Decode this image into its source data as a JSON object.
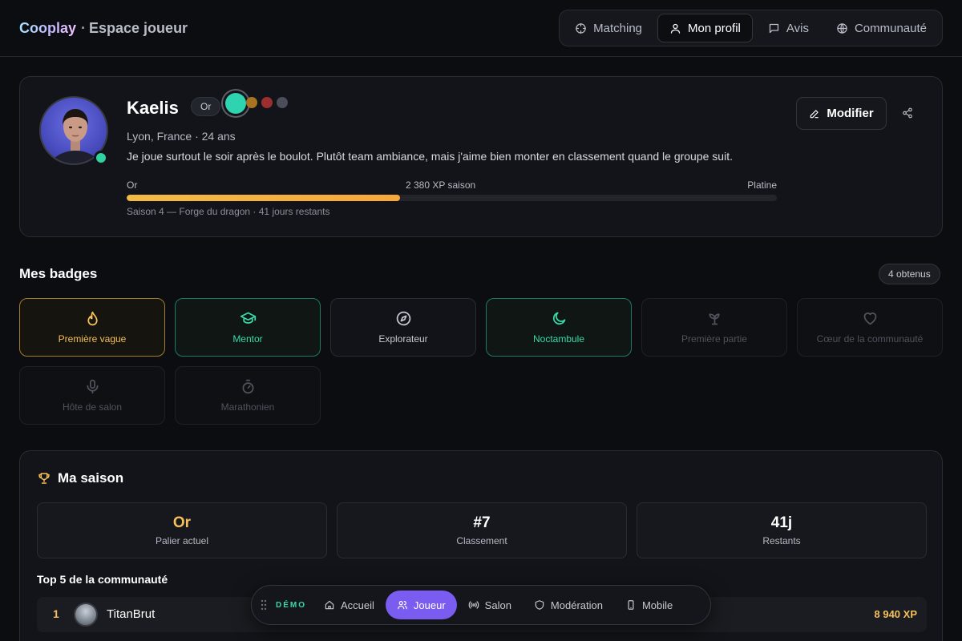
{
  "header": {
    "brand": "Cooplay",
    "separator": "·",
    "subtitle": "Espace joueur",
    "nav": [
      {
        "label": "Matching",
        "icon": "crosshair-icon"
      },
      {
        "label": "Mon profil",
        "icon": "user-icon",
        "active": true
      },
      {
        "label": "Avis",
        "icon": "message-icon"
      },
      {
        "label": "Communauté",
        "icon": "globe-icon"
      }
    ]
  },
  "profile": {
    "name": "Kaelis",
    "tier": "Or",
    "location": "Lyon, France · 24 ans",
    "bio": "Je joue surtout le soir après le boulot. Plutôt team ambiance, mais j'aime bien monter en classement quand le groupe suit.",
    "status": "online",
    "color_swatches": [
      "#2ed3b0",
      "#a8741f",
      "#9b2f2f",
      "#4a4e58"
    ],
    "xp": {
      "current_tier": "Or",
      "label": "2 380 XP saison",
      "next_tier": "Platine",
      "progress": 0.42
    },
    "season_line": "Saison 4 — Forge du dragon · 41 jours restants",
    "edit_label": "Modifier"
  },
  "badges": {
    "title": "Mes badges",
    "count": "4 obtenus",
    "items": [
      {
        "label": "Première vague",
        "icon": "flame-icon",
        "state": "gold"
      },
      {
        "label": "Mentor",
        "icon": "graduation-cap-icon",
        "state": "green"
      },
      {
        "label": "Explorateur",
        "icon": "compass-icon",
        "state": "neutral"
      },
      {
        "label": "Noctambule",
        "icon": "moon-icon",
        "state": "green"
      },
      {
        "label": "Première partie",
        "icon": "sprout-icon",
        "state": "locked"
      },
      {
        "label": "Cœur de la communauté",
        "icon": "heart-icon",
        "state": "locked"
      },
      {
        "label": "Hôte de salon",
        "icon": "microphone-icon",
        "state": "locked"
      },
      {
        "label": "Marathonien",
        "icon": "stopwatch-icon",
        "state": "locked"
      }
    ]
  },
  "season": {
    "title": "Ma saison",
    "stats": [
      {
        "value": "Or",
        "label": "Palier actuel"
      },
      {
        "value": "#7",
        "label": "Classement"
      },
      {
        "value": "41j",
        "label": "Restants"
      }
    ],
    "top5_title": "Top 5 de la communauté",
    "leaders": [
      {
        "rank": "1",
        "name": "TitanBrut",
        "xp": "8 940 XP"
      }
    ]
  },
  "dock": {
    "label": "DÉMO",
    "items": [
      {
        "label": "Accueil",
        "icon": "home-icon"
      },
      {
        "label": "Joueur",
        "icon": "users-icon",
        "active": true
      },
      {
        "label": "Salon",
        "icon": "broadcast-icon"
      },
      {
        "label": "Modération",
        "icon": "shield-icon"
      },
      {
        "label": "Mobile",
        "icon": "smartphone-icon"
      }
    ]
  },
  "colors": {
    "accent_gold": "#f5c05a",
    "accent_green": "#39d9a8",
    "accent_violet": "#7a5cf0",
    "background": "#0c0d11"
  }
}
